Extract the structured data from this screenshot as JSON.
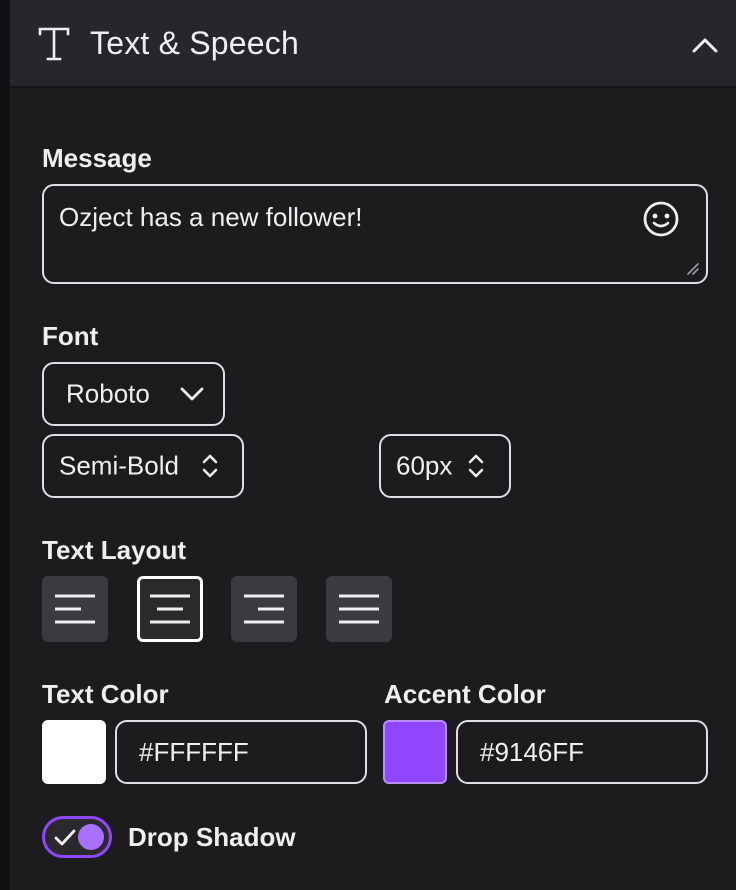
{
  "panel": {
    "title": "Text & Speech",
    "collapse_icon": "chevron-up-icon"
  },
  "message": {
    "label": "Message",
    "value": "Ozject has a new follower!",
    "emoji_icon": "smiley-icon"
  },
  "font": {
    "label": "Font",
    "family": "Roboto",
    "weight": "Semi-Bold",
    "size": "60px"
  },
  "layout": {
    "label": "Text Layout",
    "options": [
      "align-left",
      "align-center",
      "align-right",
      "justify"
    ],
    "selected": "align-center"
  },
  "text_color": {
    "label": "Text Color",
    "value": "#FFFFFF",
    "swatch": "#FFFFFF"
  },
  "accent_color": {
    "label": "Accent Color",
    "value": "#9146FF",
    "swatch": "#9146FF"
  },
  "drop_shadow": {
    "label": "Drop Shadow",
    "enabled": true
  }
}
